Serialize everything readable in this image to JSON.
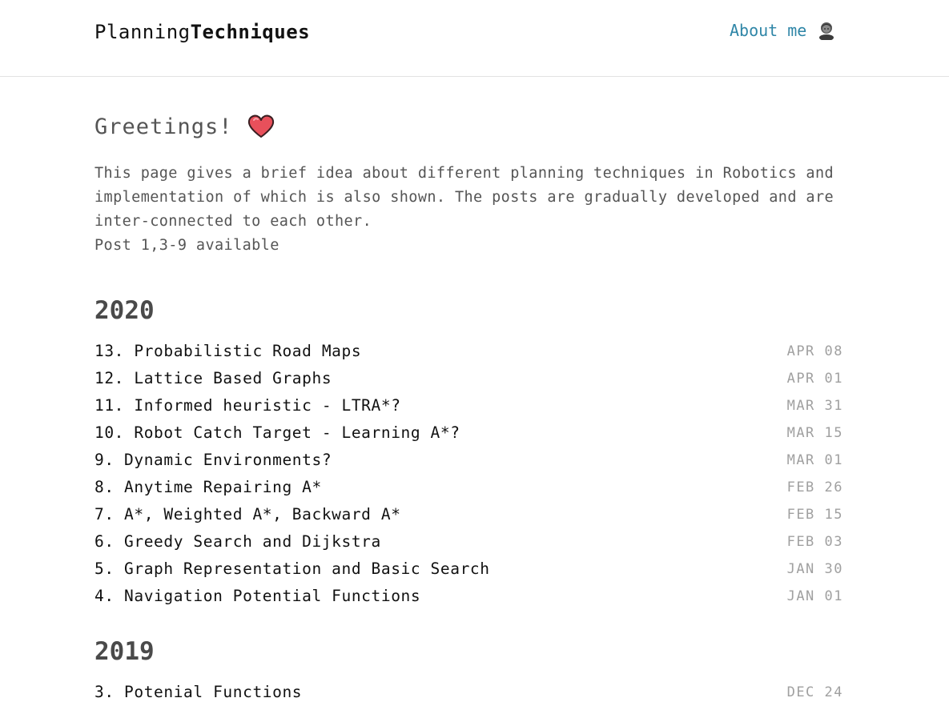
{
  "header": {
    "brand_prefix": "Planning",
    "brand_bold": "Techniques",
    "about_label": "About me",
    "about_icon": "person-icon",
    "link_color": "#2f86a7"
  },
  "intro": {
    "greeting": "Greetings!",
    "greeting_icon": "heart-icon",
    "paragraph": "This page gives a brief idea about different planning techniques in Robotics and implementation of which is also shown. The posts are gradually developed and are inter-connected to each other.",
    "availability": "Post 1,3-9 available"
  },
  "years": [
    {
      "year": "2020",
      "posts": [
        {
          "title": "13. Probabilistic Road Maps",
          "date": "APR 08"
        },
        {
          "title": "12. Lattice Based Graphs",
          "date": "APR 01"
        },
        {
          "title": "11. Informed heuristic - LTRA*?",
          "date": "MAR 31"
        },
        {
          "title": "10. Robot Catch Target - Learning A*?",
          "date": "MAR 15"
        },
        {
          "title": "9. Dynamic Environments?",
          "date": "MAR 01"
        },
        {
          "title": "8. Anytime Repairing A*",
          "date": "FEB 26"
        },
        {
          "title": "7. A*, Weighted A*, Backward A*",
          "date": "FEB 15"
        },
        {
          "title": "6. Greedy Search and Dijkstra",
          "date": "FEB 03"
        },
        {
          "title": "5. Graph Representation and Basic Search",
          "date": "JAN 30"
        },
        {
          "title": "4. Navigation Potential Functions",
          "date": "JAN 01"
        }
      ]
    },
    {
      "year": "2019",
      "posts": [
        {
          "title": "3. Potenial Functions",
          "date": "DEC 24"
        }
      ]
    }
  ]
}
